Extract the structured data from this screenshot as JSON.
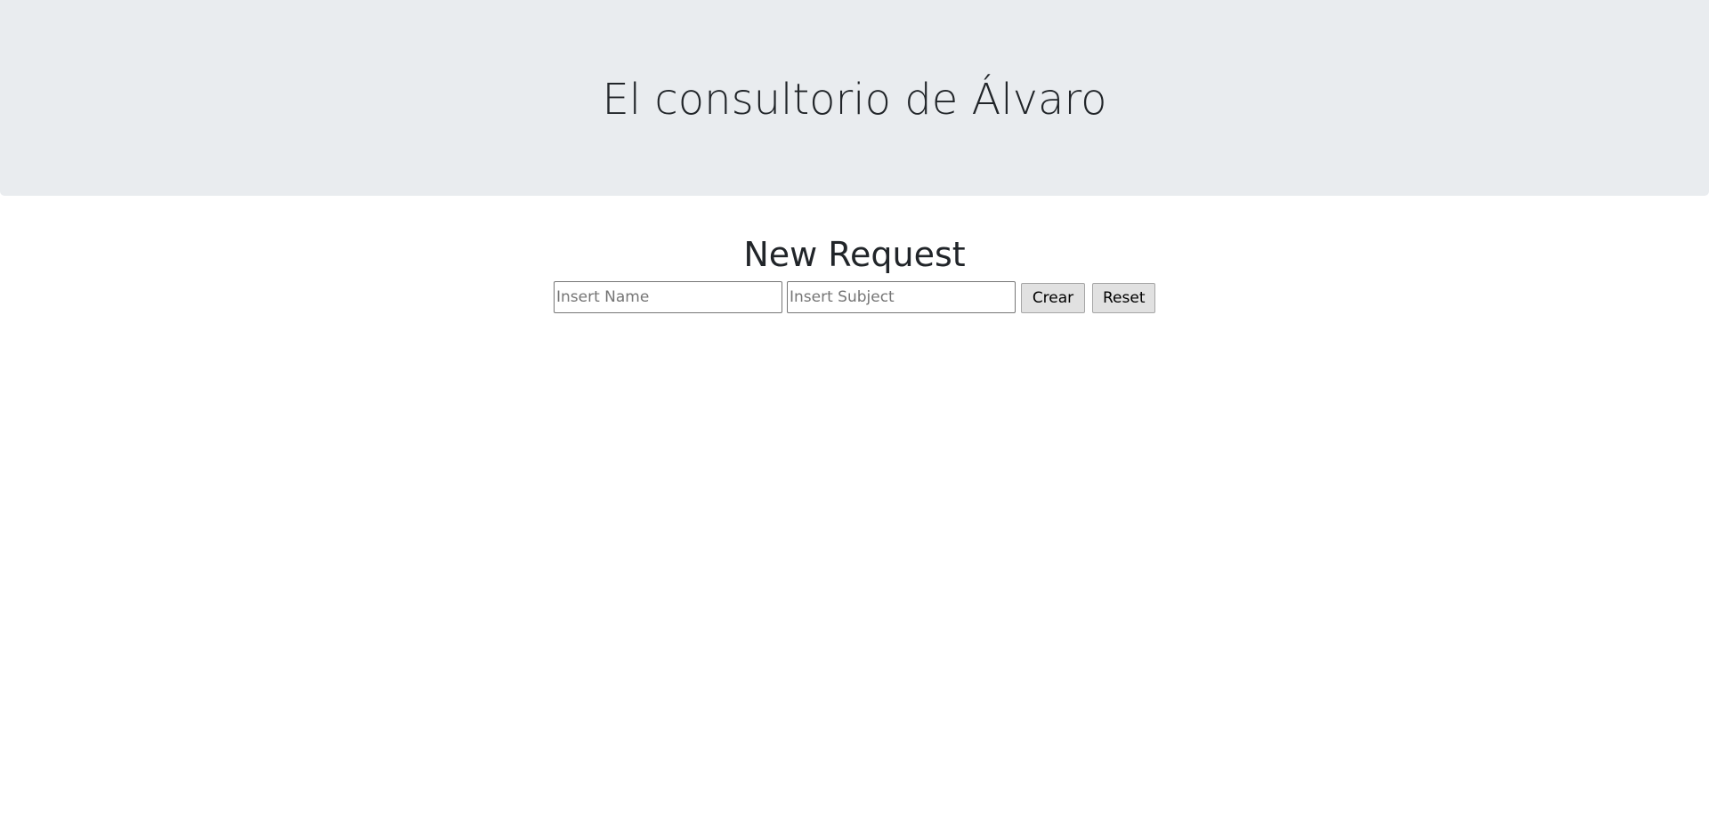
{
  "header": {
    "title": "El consultorio de Álvaro"
  },
  "request_form": {
    "heading": "New Request",
    "name_input": {
      "value": "",
      "placeholder": "Insert Name"
    },
    "subject_input": {
      "value": "",
      "placeholder": "Insert Subject"
    },
    "create_label": "Crear",
    "reset_label": "Reset"
  },
  "colors": {
    "header_background": "#e9ecef",
    "text": "#212529",
    "button_background": "#e1e1e1",
    "page_background": "#ffffff"
  }
}
